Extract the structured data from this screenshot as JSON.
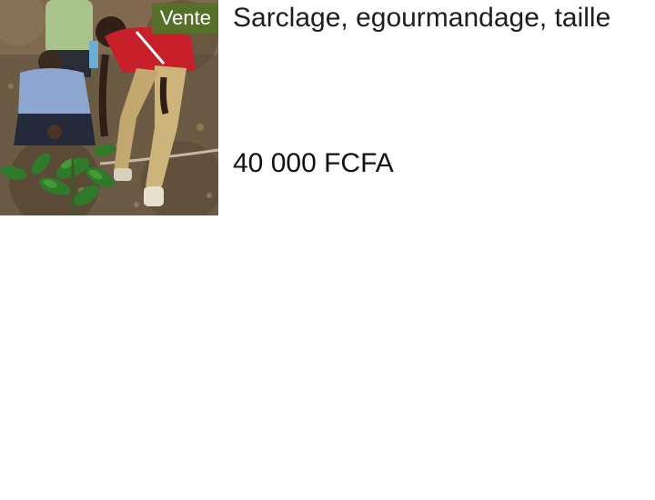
{
  "listing": {
    "badge": "Vente",
    "title": "Sarclage, egourmandage, taille",
    "price": "40 000 FCFA",
    "photo_icon": "photo-farmers-coffee-plant"
  },
  "colors": {
    "badge_background": "#56702a",
    "badge_text": "#ffffff",
    "title_text": "#1e1e1e",
    "price_text": "#111111",
    "page_background": "#ffffff"
  }
}
